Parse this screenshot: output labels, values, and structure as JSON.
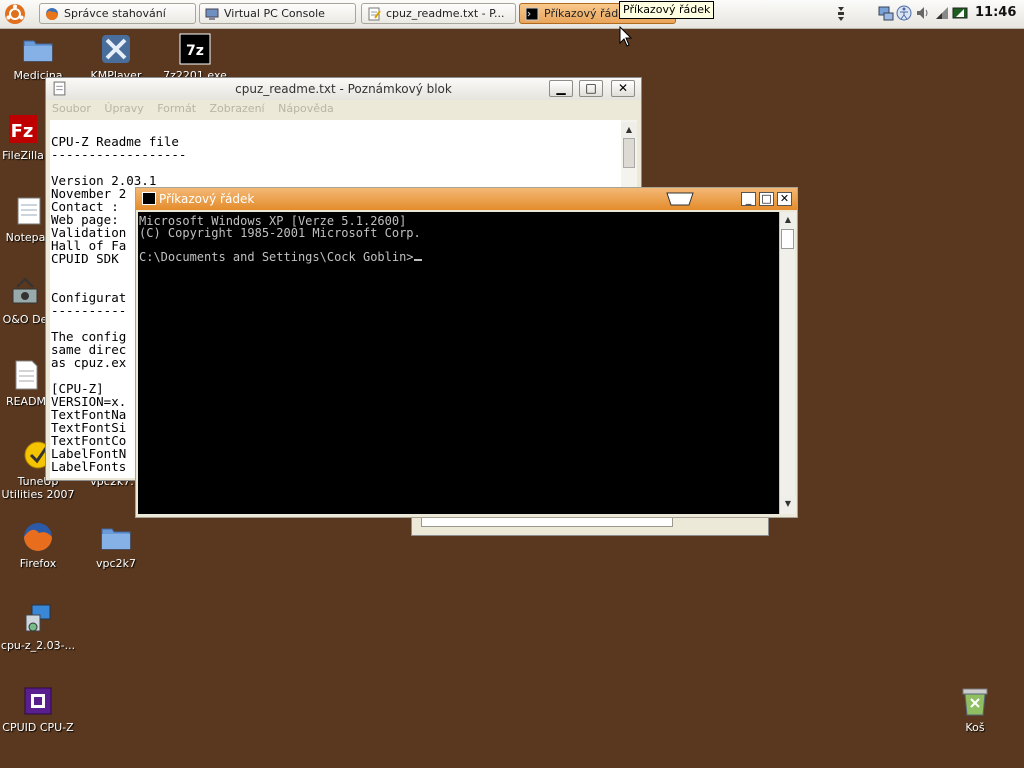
{
  "taskbar": {
    "tasks": [
      {
        "label": "Správce stahování"
      },
      {
        "label": "Virtual PC Console"
      },
      {
        "label": "cpuz_readme.txt - P..."
      },
      {
        "label": "Příkazový řádek"
      }
    ],
    "tooltip": "Příkazový řádek",
    "clock": "11:46"
  },
  "desktop": {
    "icons": [
      {
        "label": "Medicina"
      },
      {
        "label": "KMPlayer"
      },
      {
        "label": "7z2201.exe"
      },
      {
        "label": "FileZilla"
      },
      {
        "label": "Notepad"
      },
      {
        "label": "O&O De"
      },
      {
        "label": "READM"
      },
      {
        "label": "TuneUp Utilities 2007"
      },
      {
        "label": "vpc2k7."
      },
      {
        "label": "Firefox"
      },
      {
        "label": "vpc2k7"
      },
      {
        "label": "cpu-z_2.03-..."
      },
      {
        "label": "CPUID CPU-Z"
      },
      {
        "label": "Koš"
      }
    ]
  },
  "notepad": {
    "title": "cpuz_readme.txt - Poznámkový blok",
    "menu": [
      "Soubor",
      "Úpravy",
      "Formát",
      "Zobrazení",
      "Nápověda"
    ],
    "lines": [
      "CPU-Z Readme file",
      "------------------",
      "",
      "Version 2.03.1",
      "November 2",
      "Contact :",
      "Web page:",
      "Validation",
      "Hall of Fa",
      "CPUID SDK",
      "",
      "",
      "Configurat",
      "----------",
      "",
      "The config",
      "same direc",
      "as cpuz.ex",
      "",
      "[CPU-Z]",
      "VERSION=x.",
      "TextFontNa",
      "TextFontSi",
      "TextFontCo",
      "LabelFontN",
      "LabelFonts"
    ]
  },
  "cmd": {
    "title": "Příkazový řádek",
    "lines": [
      "Microsoft Windows XP [Verze 5.1.2600]",
      "(C) Copyright 1985-2001 Microsoft Corp.",
      "",
      "C:\\Documents and Settings\\Cock Goblin>"
    ]
  },
  "colors": {
    "desktop": "#59381f",
    "active_task": "#e9a45b",
    "cmd_titlebar": "#e48c2b"
  }
}
